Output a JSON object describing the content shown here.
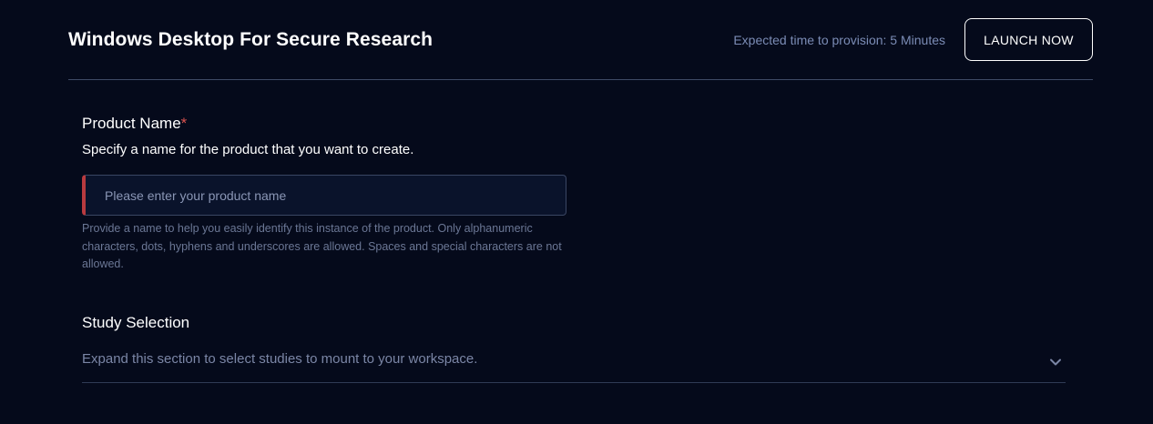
{
  "header": {
    "title": "Windows Desktop For Secure Research",
    "provision_text": "Expected time to provision: 5 Minutes",
    "launch_label": "LAUNCH NOW"
  },
  "product_name": {
    "label": "Product Name",
    "required_marker": "*",
    "description": "Specify a name for the product that you want to create.",
    "placeholder": "Please enter your product name",
    "value": "",
    "help": "Provide a name to help you easily identify this instance of the product. Only alphanumeric characters, dots, hyphens and underscores are allowed. Spaces and special characters are not allowed."
  },
  "study_selection": {
    "label": "Study Selection",
    "description": "Expand this section to select studies to mount to your workspace.",
    "icon": "chevron-down-icon"
  },
  "colors": {
    "background": "#050a1b",
    "error_accent": "#b83a3f",
    "muted_text": "#7b8cb5"
  }
}
